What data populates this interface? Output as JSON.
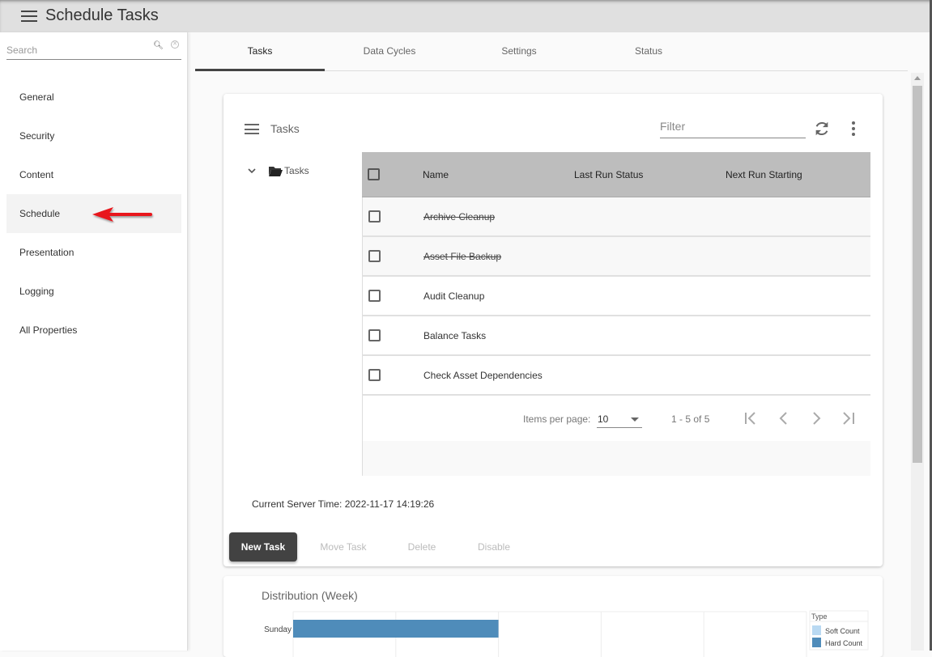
{
  "app": {
    "title": "Schedule Tasks"
  },
  "sidebar": {
    "search_placeholder": "Search",
    "items": [
      {
        "label": "General"
      },
      {
        "label": "Security"
      },
      {
        "label": "Content"
      },
      {
        "label": "Schedule",
        "active": true
      },
      {
        "label": "Presentation"
      },
      {
        "label": "Logging"
      },
      {
        "label": "All Properties"
      }
    ]
  },
  "tabs": [
    {
      "label": "Tasks",
      "active": true
    },
    {
      "label": "Data Cycles"
    },
    {
      "label": "Settings"
    },
    {
      "label": "Status"
    }
  ],
  "tasks_card": {
    "title": "Tasks",
    "filter_placeholder": "Filter",
    "tree_root": "Tasks",
    "columns": [
      "Name",
      "Last Run Status",
      "Next Run Starting"
    ],
    "rows": [
      {
        "name": "Archive Cleanup",
        "last_run_status": "",
        "next_run_starting": "",
        "disabled": true
      },
      {
        "name": "Asset File Backup",
        "last_run_status": "",
        "next_run_starting": "",
        "disabled": true
      },
      {
        "name": "Audit Cleanup",
        "last_run_status": "",
        "next_run_starting": "",
        "disabled": false
      },
      {
        "name": "Balance Tasks",
        "last_run_status": "",
        "next_run_starting": "",
        "disabled": false
      },
      {
        "name": "Check Asset Dependencies",
        "last_run_status": "",
        "next_run_starting": "",
        "disabled": false
      }
    ],
    "paginator": {
      "items_per_page_label": "Items per page:",
      "items_per_page": "10",
      "range": "1 - 5 of 5"
    },
    "server_time": "Current Server Time: 2022-11-17 14:19:26",
    "buttons": {
      "new_task": "New Task",
      "move_task": "Move Task",
      "delete": "Delete",
      "disable": "Disable"
    }
  },
  "chart_data": {
    "type": "bar",
    "orientation": "horizontal",
    "title": "Distribution  (Week)",
    "categories": [
      "Sunday"
    ],
    "series": [
      {
        "name": "Soft Count",
        "color": "#b9d9f2",
        "values": [
          0
        ]
      },
      {
        "name": "Hard Count",
        "color": "#4f8cba",
        "values": [
          2
        ]
      }
    ],
    "xlim": [
      0,
      5
    ],
    "grid": true,
    "legend_title": "Type",
    "legend_position": "right"
  }
}
